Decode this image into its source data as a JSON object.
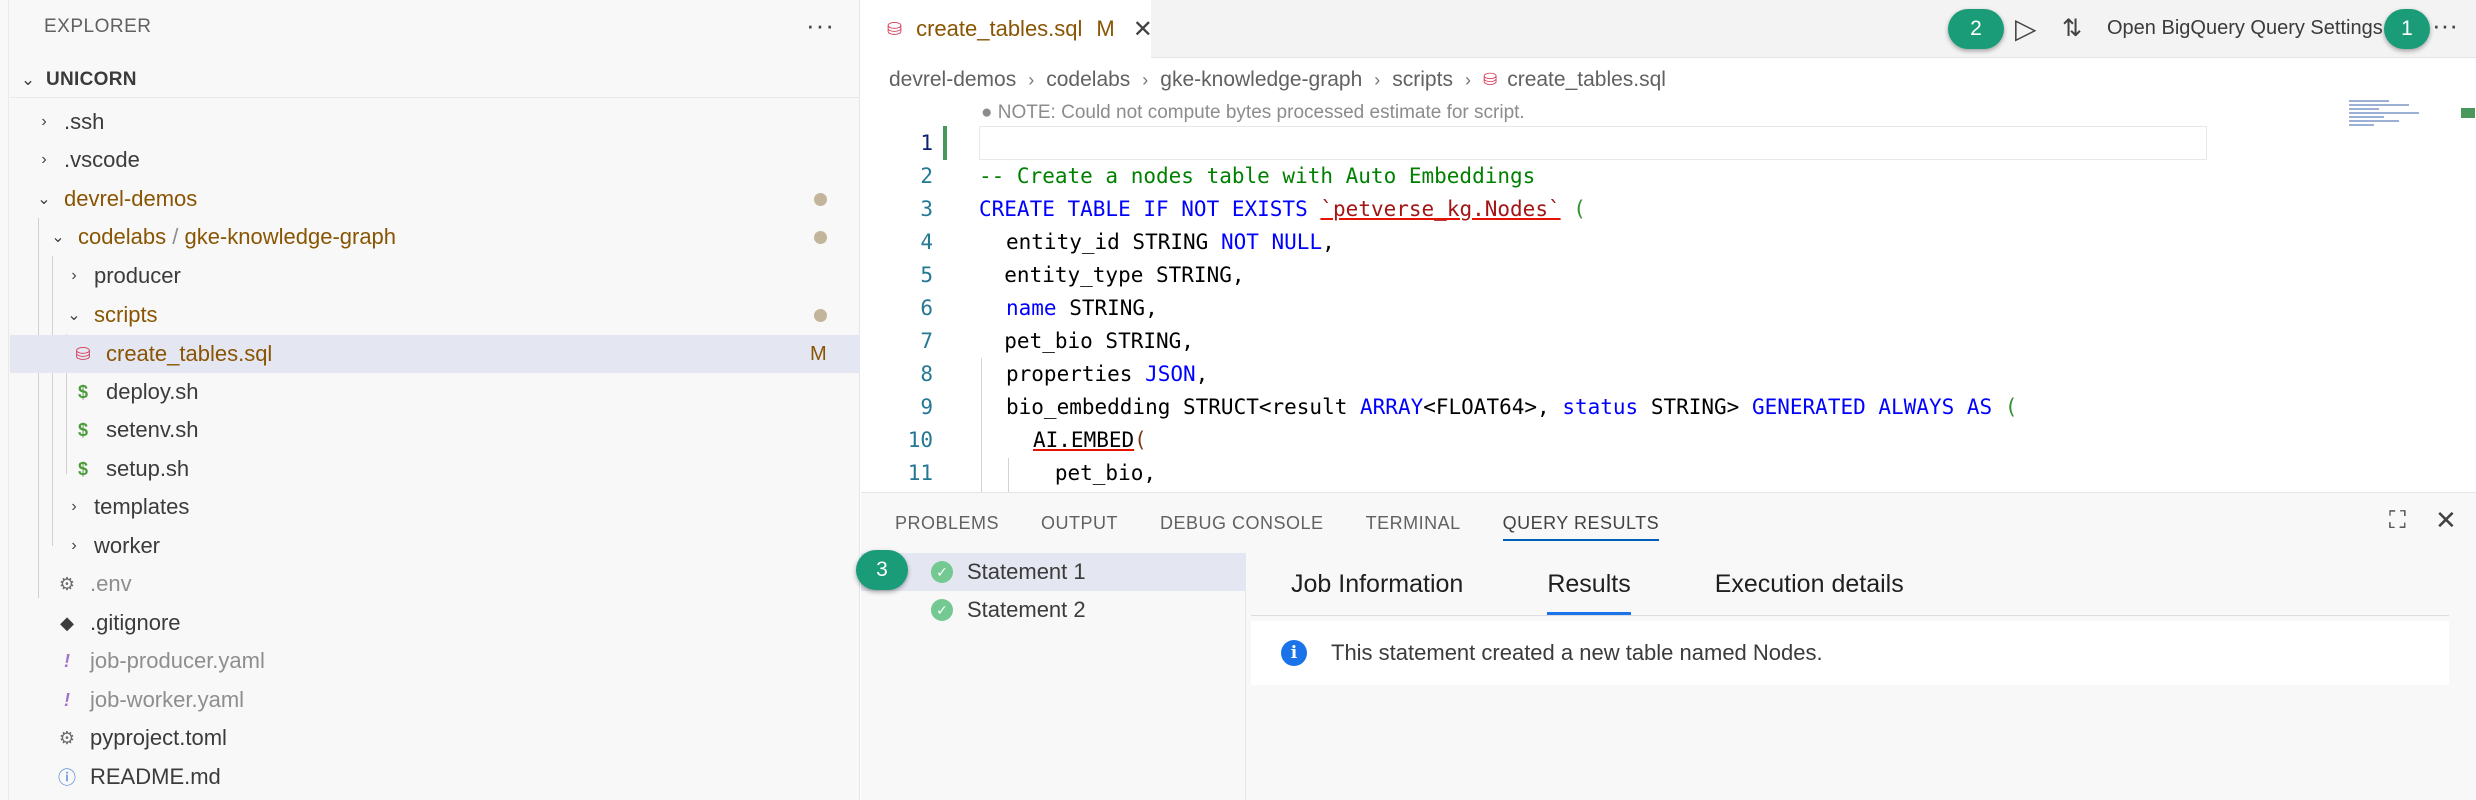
{
  "explorer": {
    "header": "EXPLORER",
    "more": "···",
    "root": "UNICORN",
    "items": [
      {
        "label": ".ssh",
        "type": "folder",
        "expanded": false
      },
      {
        "label": ".vscode",
        "type": "folder",
        "expanded": false
      },
      {
        "label": "devrel-demos",
        "type": "folder",
        "expanded": true
      },
      {
        "label": "codelabs",
        "type": "folder",
        "expanded": true
      },
      {
        "label": "gke-knowledge-graph",
        "type": "folder"
      },
      {
        "label": "producer",
        "type": "folder",
        "expanded": false
      },
      {
        "label": "scripts",
        "type": "folder",
        "expanded": true
      },
      {
        "label": "create_tables.sql",
        "type": "file",
        "icon": "database-icon",
        "badge": "M"
      },
      {
        "label": "deploy.sh",
        "type": "file",
        "icon": "dollar-icon"
      },
      {
        "label": "setenv.sh",
        "type": "file",
        "icon": "dollar-icon"
      },
      {
        "label": "setup.sh",
        "type": "file",
        "icon": "dollar-icon"
      },
      {
        "label": "templates",
        "type": "folder",
        "expanded": false
      },
      {
        "label": "worker",
        "type": "folder",
        "expanded": false
      },
      {
        "label": ".env",
        "type": "file",
        "icon": "gear-icon"
      },
      {
        "label": ".gitignore",
        "type": "file",
        "icon": "git-icon"
      },
      {
        "label": "job-producer.yaml",
        "type": "file",
        "icon": "exclamation-icon"
      },
      {
        "label": "job-worker.yaml",
        "type": "file",
        "icon": "exclamation-icon"
      },
      {
        "label": "pyproject.toml",
        "type": "file",
        "icon": "gear-icon"
      },
      {
        "label": "README.md",
        "type": "file",
        "icon": "info-icon"
      }
    ],
    "path_separator": "/"
  },
  "editor": {
    "tab": {
      "name": "create_tables.sql",
      "badge": "M"
    },
    "actions": {
      "callout_1": "1",
      "callout_2": "2",
      "open_settings": "Open BigQuery Query Settings"
    },
    "breadcrumb": [
      "devrel-demos",
      "codelabs",
      "gke-knowledge-graph",
      "scripts",
      "create_tables.sql"
    ],
    "note": "NOTE: Could not compute bytes processed estimate for script.",
    "line_numbers": [
      "1",
      "2",
      "3",
      "4",
      "5",
      "6",
      "7",
      "8",
      "9",
      "10",
      "11"
    ],
    "lines": [
      "",
      "-- Create a nodes table with Auto Embeddings",
      "CREATE TABLE IF NOT EXISTS `petverse_kg.Nodes` (",
      "  entity_id STRING NOT NULL,",
      "  entity_type STRING,",
      "  name STRING,",
      "  pet_bio STRING,",
      "  properties JSON,",
      "  bio_embedding STRUCT<result ARRAY<FLOAT64>, status STRING> GENERATED ALWAYS AS (",
      "    AI.EMBED(",
      "      pet_bio,"
    ],
    "tokens": {
      "l3_kw1": "CREATE TABLE IF NOT EXISTS",
      "l3_str": "`petverse_kg.Nodes`",
      "l3_paren": "(",
      "l4_a": "entity_id STRING",
      "l4_kw": "NOT NULL",
      "l4_b": ",",
      "l6_kw": "name",
      "l6_b": " STRING,",
      "l8_a": "properties ",
      "l8_kw": "JSON",
      "l8_b": ",",
      "l9_a": "bio_embedding STRUCT<result ",
      "l9_kw1": "ARRAY",
      "l9_b": "<FLOAT64>, ",
      "l9_kw2": "status",
      "l9_c": " STRING> ",
      "l9_kw3": "GENERATED ALWAYS AS",
      "l9_paren": "(",
      "l10_fn": "AI.EMBED",
      "l10_paren": "("
    }
  },
  "panel": {
    "tabs": [
      "PROBLEMS",
      "OUTPUT",
      "DEBUG CONSOLE",
      "TERMINAL",
      "QUERY RESULTS"
    ],
    "active_tab": "QUERY RESULTS",
    "callout_3": "3",
    "statements": [
      "Statement 1",
      "Statement 2"
    ],
    "result_tabs": [
      "Job Information",
      "Results",
      "Execution details"
    ],
    "active_result_tab": "Results",
    "message": "This statement created a new table named Nodes."
  },
  "colors": {
    "accent": "#005fb8",
    "callout": "#1a9c78",
    "modified": "#895503",
    "success": "#73c991"
  }
}
